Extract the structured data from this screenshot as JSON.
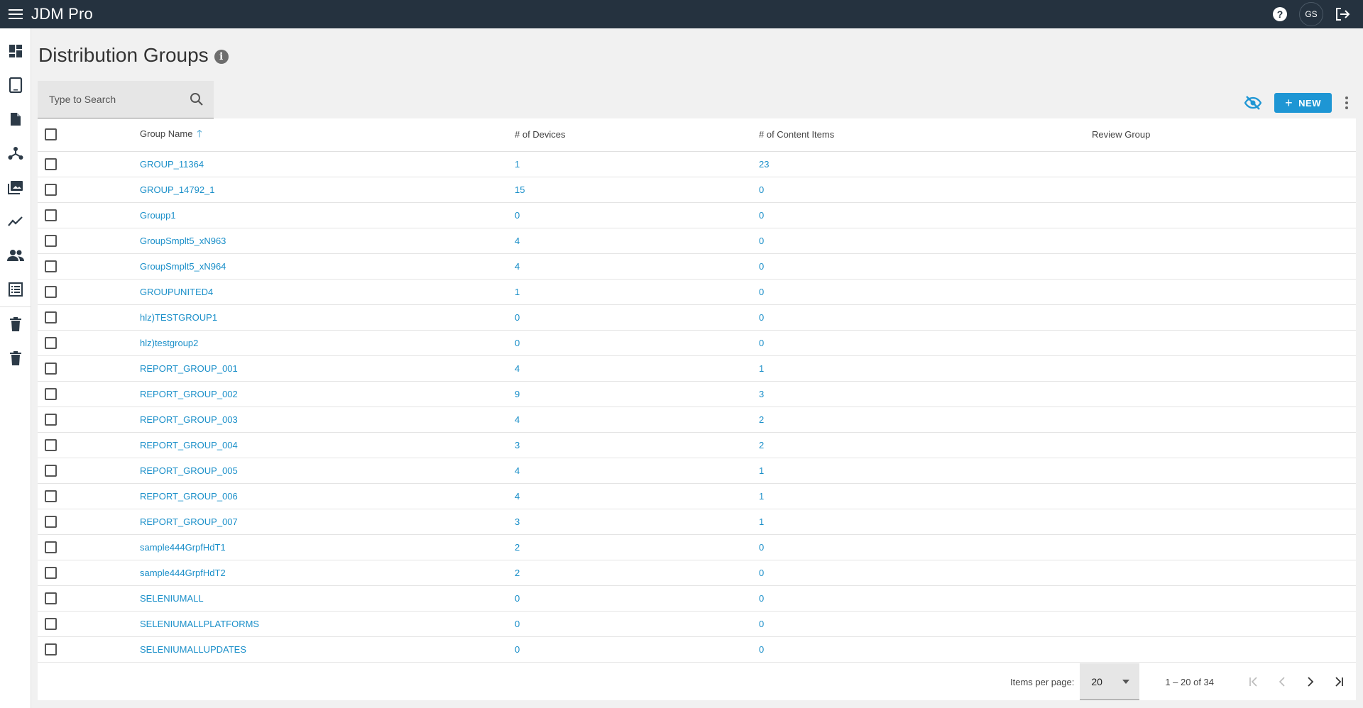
{
  "app": {
    "title": "JDM Pro",
    "user_initials": "GS"
  },
  "page": {
    "title": "Distribution Groups"
  },
  "search": {
    "placeholder": "Type to Search"
  },
  "toolbar": {
    "new_label": "NEW"
  },
  "table": {
    "columns": {
      "name": "Group Name",
      "devices": "# of Devices",
      "content": "# of Content Items",
      "review": "Review Group"
    },
    "rows": [
      {
        "name": "GROUP_11364",
        "devices": "1",
        "content": "23",
        "review": ""
      },
      {
        "name": "GROUP_14792_1",
        "devices": "15",
        "content": "0",
        "review": ""
      },
      {
        "name": "Groupp1",
        "devices": "0",
        "content": "0",
        "review": ""
      },
      {
        "name": "GroupSmplt5_xN963",
        "devices": "4",
        "content": "0",
        "review": ""
      },
      {
        "name": "GroupSmplt5_xN964",
        "devices": "4",
        "content": "0",
        "review": ""
      },
      {
        "name": "GROUPUNITED4",
        "devices": "1",
        "content": "0",
        "review": ""
      },
      {
        "name": "hlz)TESTGROUP1",
        "devices": "0",
        "content": "0",
        "review": ""
      },
      {
        "name": "hlz)testgroup2",
        "devices": "0",
        "content": "0",
        "review": ""
      },
      {
        "name": "REPORT_GROUP_001",
        "devices": "4",
        "content": "1",
        "review": ""
      },
      {
        "name": "REPORT_GROUP_002",
        "devices": "9",
        "content": "3",
        "review": ""
      },
      {
        "name": "REPORT_GROUP_003",
        "devices": "4",
        "content": "2",
        "review": ""
      },
      {
        "name": "REPORT_GROUP_004",
        "devices": "3",
        "content": "2",
        "review": ""
      },
      {
        "name": "REPORT_GROUP_005",
        "devices": "4",
        "content": "1",
        "review": ""
      },
      {
        "name": "REPORT_GROUP_006",
        "devices": "4",
        "content": "1",
        "review": ""
      },
      {
        "name": "REPORT_GROUP_007",
        "devices": "3",
        "content": "1",
        "review": ""
      },
      {
        "name": "sample444GrpfHdT1",
        "devices": "2",
        "content": "0",
        "review": ""
      },
      {
        "name": "sample444GrpfHdT2",
        "devices": "2",
        "content": "0",
        "review": ""
      },
      {
        "name": "SELENIUMALL",
        "devices": "0",
        "content": "0",
        "review": ""
      },
      {
        "name": "SELENIUMALLPLATFORMS",
        "devices": "0",
        "content": "0",
        "review": ""
      },
      {
        "name": "SELENIUMALLUPDATES",
        "devices": "0",
        "content": "0",
        "review": ""
      }
    ]
  },
  "paginator": {
    "items_per_page_label": "Items per page:",
    "page_size": "20",
    "range": "1 – 20 of 34"
  },
  "colors": {
    "topbar": "#25323f",
    "accent": "#1e96d4",
    "link": "#1a8fc9"
  },
  "sidebar_icons": [
    "dashboard-icon",
    "tablet-icon",
    "document-icon",
    "hierarchy-icon",
    "media-icon",
    "trend-icon",
    "people-icon",
    "list-icon",
    "trash-icon",
    "trash-icon"
  ]
}
